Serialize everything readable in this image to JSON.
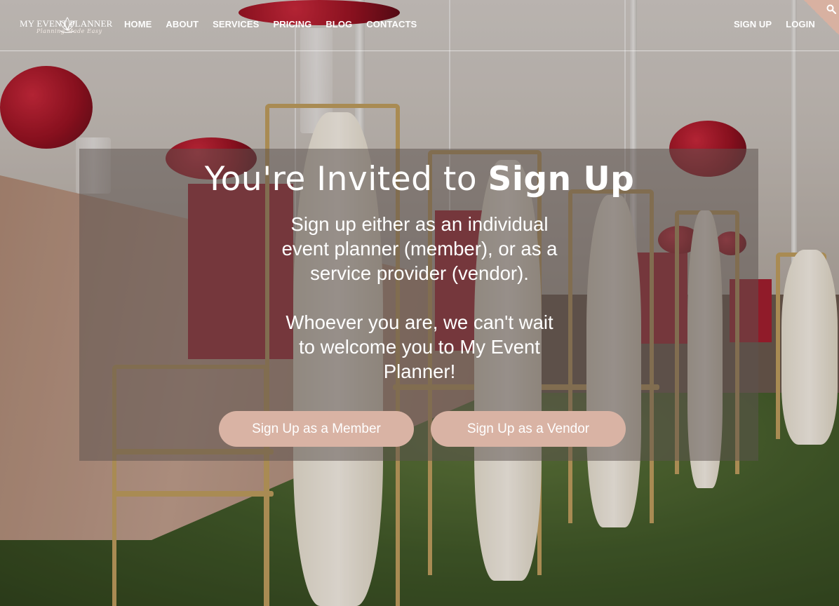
{
  "brand": {
    "name": "MY EVENT PLANNER",
    "tagline": "Planning Made Easy"
  },
  "nav": {
    "items": [
      {
        "label": "HOME"
      },
      {
        "label": "ABOUT"
      },
      {
        "label": "SERVICES"
      },
      {
        "label": "PRICING"
      },
      {
        "label": "BLOG"
      },
      {
        "label": "CONTACTS"
      }
    ]
  },
  "auth": {
    "signup_label": "SIGN UP",
    "login_label": "LOGIN"
  },
  "search": {
    "icon": "search-icon",
    "accent_color": "#d8b1a1"
  },
  "hero": {
    "title_regular": "You're Invited to ",
    "title_bold": "Sign Up",
    "paragraph_1": "Sign up either as an individual event planner (member), or as a service provider (vendor).",
    "paragraph_2": "Whoever you are, we can't wait to welcome you to My Event Planner!",
    "member_button_label": "Sign Up as a Member",
    "vendor_button_label": "Sign Up as a Vendor",
    "button_color": "#d9b3a4"
  }
}
